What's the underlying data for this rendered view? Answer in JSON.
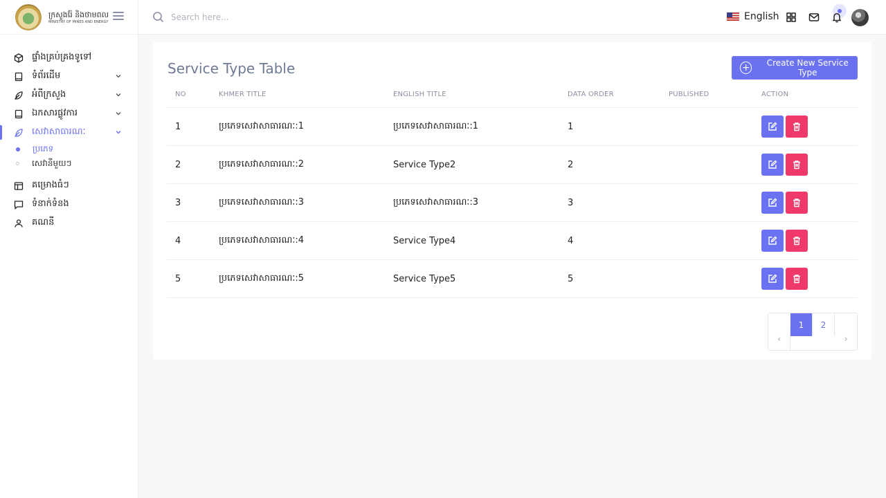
{
  "brand": {
    "title_km": "ក្រសួងរ៉ែ និងថាមពល",
    "title_en": "MINISTRY OF MINES AND ENERGY",
    "logo_icon": "ministry-seal-logo"
  },
  "sidebar": {
    "items": [
      {
        "label": "ផ្ទាំងគ្រប់គ្រងទូទៅ",
        "icon": "cube-icon",
        "chevron": false
      },
      {
        "label": "ទំព័រដើម",
        "icon": "book-icon",
        "chevron": true
      },
      {
        "label": "អំពីក្រសួង",
        "icon": "feather-icon",
        "chevron": true
      },
      {
        "label": "ឯកសារផ្លូវការ",
        "icon": "book-icon",
        "chevron": true
      },
      {
        "label": "សេវាសាធារណៈ",
        "icon": "feather-icon",
        "chevron": true,
        "active": true
      }
    ],
    "sub_items": [
      {
        "label": "ប្រភេទ",
        "active": true
      },
      {
        "label": "សេវានីមួយៗ",
        "active": false
      }
    ],
    "items_after": [
      {
        "label": "គម្រោងធំៗ",
        "icon": "layout-icon"
      },
      {
        "label": "ទំនាក់ទំនង",
        "icon": "message-icon"
      },
      {
        "label": "គណនី",
        "icon": "user-icon"
      }
    ]
  },
  "topbar": {
    "search_placeholder": "Search here...",
    "language": "English"
  },
  "card": {
    "title": "Service Type Table",
    "create_button": "Create New Service Type",
    "columns": [
      "NO",
      "KHMER TITLE",
      "ENGLISH TITLE",
      "DATA ORDER",
      "PUBLISHED",
      "ACTION"
    ],
    "rows": [
      {
        "no": "1",
        "khmer": "ប្រភេទសេវាសាធារណៈ:1",
        "english": "ប្រភេទសេវាសាធារណៈ:1",
        "order": "1",
        "published": true
      },
      {
        "no": "2",
        "khmer": "ប្រភេទសេវាសាធារណៈ:2",
        "english": "Service Type2",
        "order": "2",
        "published": true
      },
      {
        "no": "3",
        "khmer": "ប្រភេទសេវាសាធារណៈ:3",
        "english": "ប្រភេទសេវាសាធារណៈ:3",
        "order": "3",
        "published": true
      },
      {
        "no": "4",
        "khmer": "ប្រភេទសេវាសាធារណៈ:4",
        "english": "Service Type4",
        "order": "4",
        "published": true
      },
      {
        "no": "5",
        "khmer": "ប្រភេទសេវាសាធារណៈ:5",
        "english": "Service Type5",
        "order": "5",
        "published": true
      }
    ],
    "pagination": {
      "prev": "‹",
      "pages": [
        "1",
        "2"
      ],
      "current": "1",
      "next": "›"
    }
  },
  "colors": {
    "accent": "#6b72f2",
    "danger": "#f0396b",
    "title": "#6e7a94"
  }
}
